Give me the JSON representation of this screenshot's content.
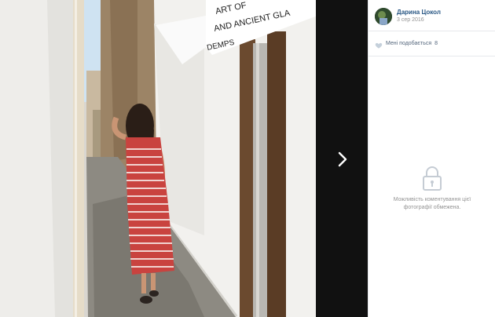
{
  "post": {
    "author_name": "Дарина Цокол",
    "date": "3 сер 2016"
  },
  "likes": {
    "label": "Мені подобається",
    "count": "8"
  },
  "comments": {
    "closed_text": "Можливість коментування цієї фотографії обмежена."
  },
  "photo": {
    "sign_lines": [
      "ART OF",
      "AND ANCIENT GLA",
      "DEMPS"
    ]
  },
  "icons": {
    "next": "chevron-right-icon",
    "like": "heart-icon",
    "lock": "lock-icon"
  },
  "colors": {
    "stage_background": "#111111",
    "author_link": "#2a5885",
    "muted_text": "#939393",
    "like_heart": "#c5d0db"
  }
}
